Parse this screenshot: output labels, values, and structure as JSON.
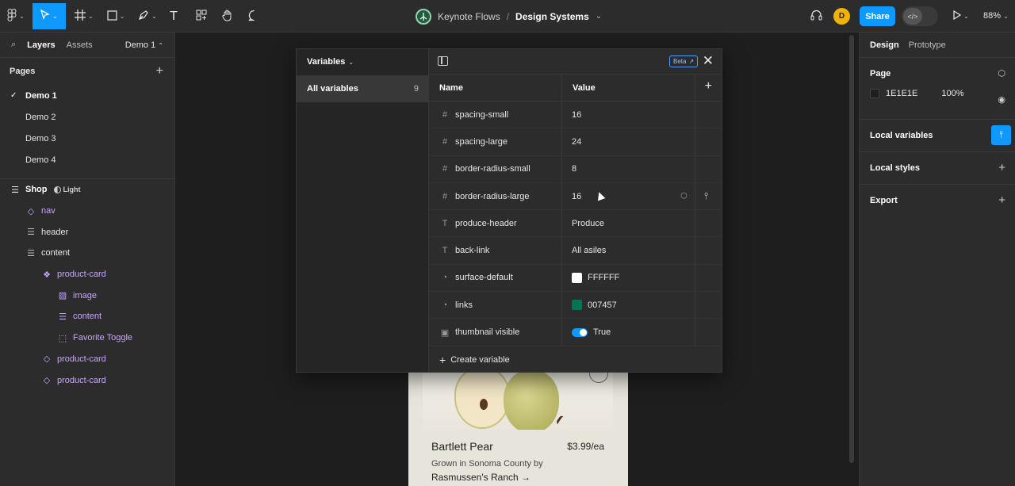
{
  "toolbar": {
    "file_team": "Keynote Flows",
    "breadcrumb_sep": "/",
    "file_name": "Design Systems",
    "avatar_initial": "D",
    "share_label": "Share",
    "zoom": "88%"
  },
  "left_panel": {
    "tabs": [
      "Layers",
      "Assets"
    ],
    "current_page": "Demo 1",
    "pages_title": "Pages",
    "pages": [
      "Demo 1",
      "Demo 2",
      "Demo 3",
      "Demo 4"
    ],
    "frame_name": "Shop",
    "frame_mode": "Light",
    "layers": [
      {
        "name": "nav"
      },
      {
        "name": "header"
      },
      {
        "name": "content"
      },
      {
        "name": "product-card"
      },
      {
        "name": "image"
      },
      {
        "name": "content"
      },
      {
        "name": "Favorite Toggle"
      },
      {
        "name": "product-card"
      },
      {
        "name": "product-card"
      }
    ]
  },
  "variables_modal": {
    "title": "Variables",
    "collection": "All variables",
    "collection_count": "9",
    "beta_label": "Beta",
    "col_name": "Name",
    "col_value": "Value",
    "rows": [
      {
        "name": "spacing-small",
        "value": "16"
      },
      {
        "name": "spacing-large",
        "value": "24"
      },
      {
        "name": "border-radius-small",
        "value": "8"
      },
      {
        "name": "border-radius-large",
        "value": "16"
      },
      {
        "name": "produce-header",
        "value": "Produce"
      },
      {
        "name": "back-link",
        "value": "All asiles"
      },
      {
        "name": "surface-default",
        "value": "FFFFFF"
      },
      {
        "name": "links",
        "value": "007457"
      },
      {
        "name": "thumbnail visible",
        "value": "True"
      }
    ],
    "create_label": "Create variable"
  },
  "product_card": {
    "name": "Bartlett Pear",
    "price": "$3.99/ea",
    "desc": "Grown in Sonoma County by",
    "link": "Rasmussen's Ranch →"
  },
  "right_panel": {
    "tabs": [
      "Design",
      "Prototype"
    ],
    "page_title": "Page",
    "page_fill": "1E1E1E",
    "page_opacity": "100%",
    "local_variables": "Local variables",
    "local_styles": "Local styles",
    "export": "Export"
  },
  "colors": {
    "accent": "#0d99ff",
    "surface_default": "#FFFFFF",
    "links": "#007457"
  }
}
